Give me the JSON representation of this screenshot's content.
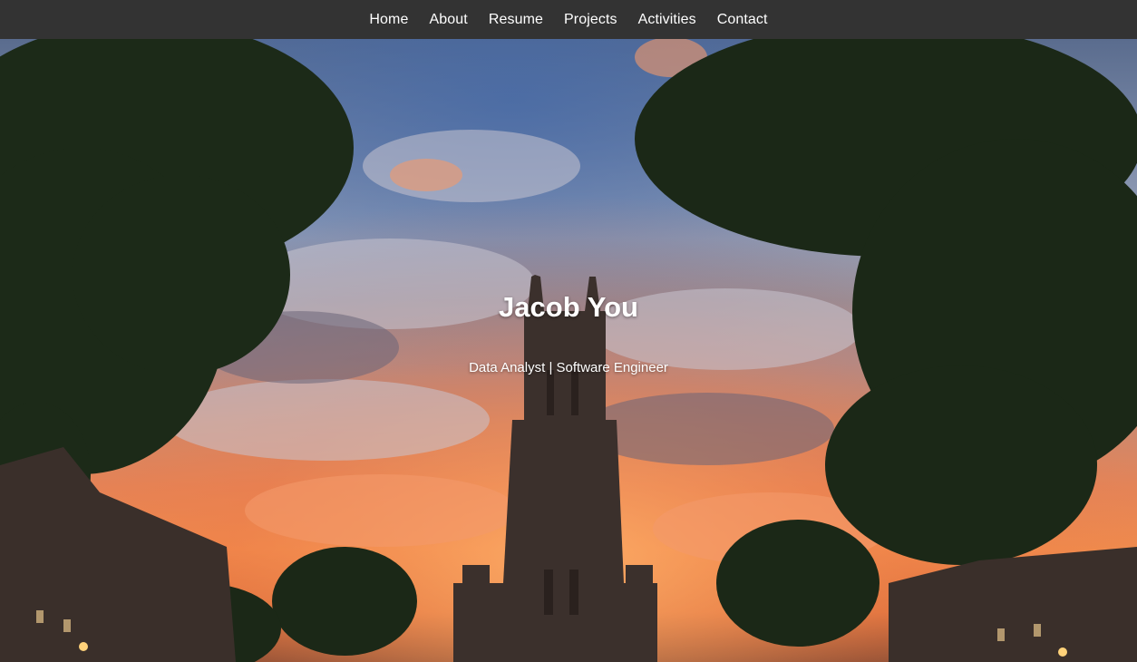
{
  "nav": {
    "items": [
      {
        "label": "Home"
      },
      {
        "label": "About"
      },
      {
        "label": "Resume"
      },
      {
        "label": "Projects"
      },
      {
        "label": "Activities"
      },
      {
        "label": "Contact"
      }
    ]
  },
  "hero": {
    "title": "Jacob You",
    "subtitle": "Data Analyst | Software Engineer",
    "image": "tower-at-sunset-photo"
  },
  "colors": {
    "navbar_bg": "#333333",
    "nav_text": "#ffffff",
    "hero_text": "#ffffff"
  }
}
